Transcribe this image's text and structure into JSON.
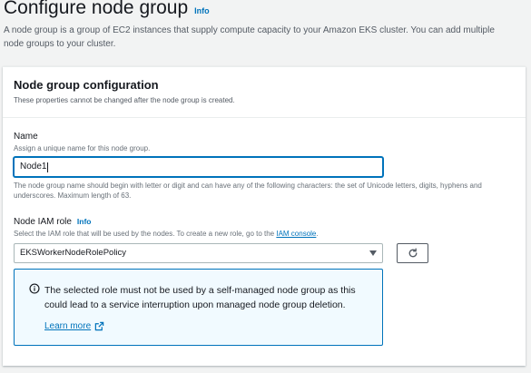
{
  "header": {
    "title": "Configure node group",
    "info_label": "Info",
    "description": "A node group is a group of EC2 instances that supply compute capacity to your Amazon EKS cluster. You can add multiple node groups to your cluster."
  },
  "panel": {
    "title": "Node group configuration",
    "subtitle": "These properties cannot be changed after the node group is created."
  },
  "name_field": {
    "label": "Name",
    "description": "Assign a unique name for this node group.",
    "value": "Node1",
    "constraint": "The node group name should begin with letter or digit and can have any of the following characters: the set of Unicode letters, digits, hyphens and underscores. Maximum length of 63."
  },
  "iam_role": {
    "label": "Node IAM role",
    "info_label": "Info",
    "description_prefix": "Select the IAM role that will be used by the nodes. To create a new role, go to the ",
    "description_link": "IAM console",
    "description_suffix": ".",
    "selected_value": "EKSWorkerNodeRolePolicy"
  },
  "alert": {
    "message": "The selected role must not be used by a self-managed node group as this could lead to a service interruption upon managed node group deletion.",
    "link_label": "Learn more"
  },
  "colors": {
    "accent": "#0073bb",
    "alert_bg": "#f1faff",
    "page_bg": "#f2f3f3"
  }
}
